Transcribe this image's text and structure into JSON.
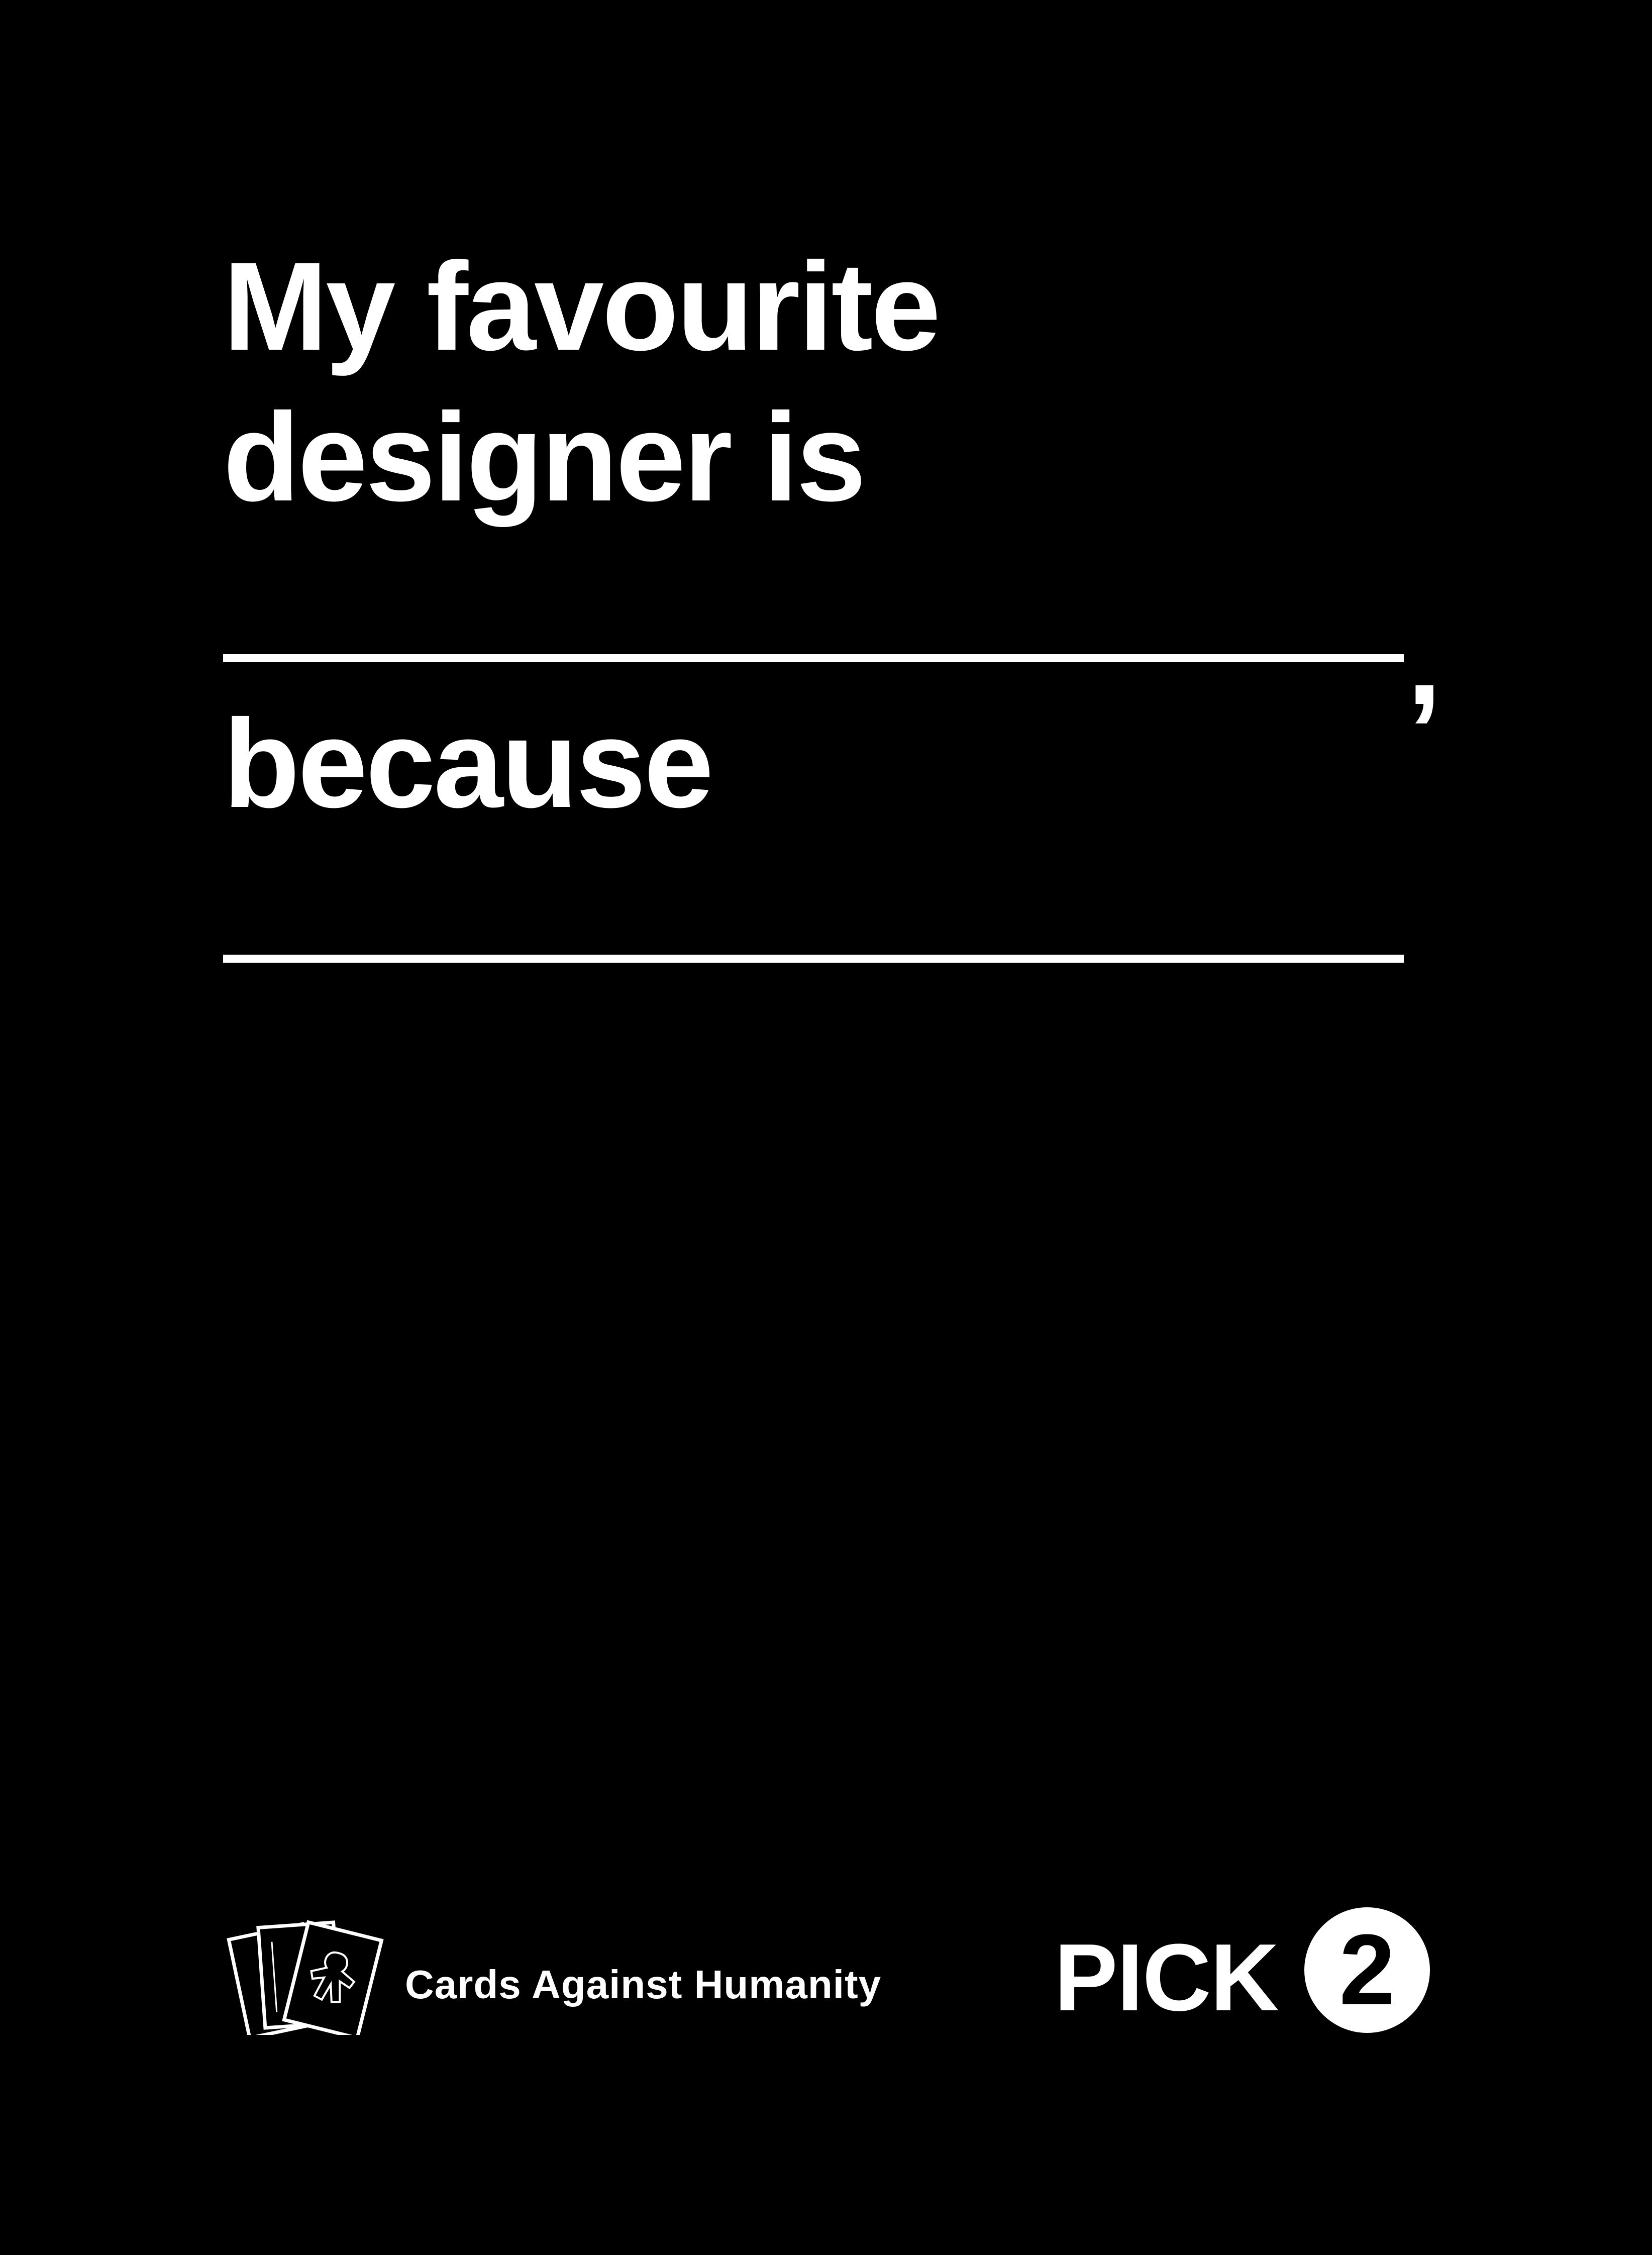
{
  "card": {
    "line_1": "My favourite",
    "line_2": "designer is",
    "comma": ",",
    "line_3": "because"
  },
  "footer": {
    "brand": "Cards Against Humanity",
    "pick_label": "PICK",
    "pick_number": "2"
  },
  "colors": {
    "background": "#000000",
    "text": "#ffffff"
  },
  "icons": {
    "logo": "stacked-cards-icon"
  }
}
